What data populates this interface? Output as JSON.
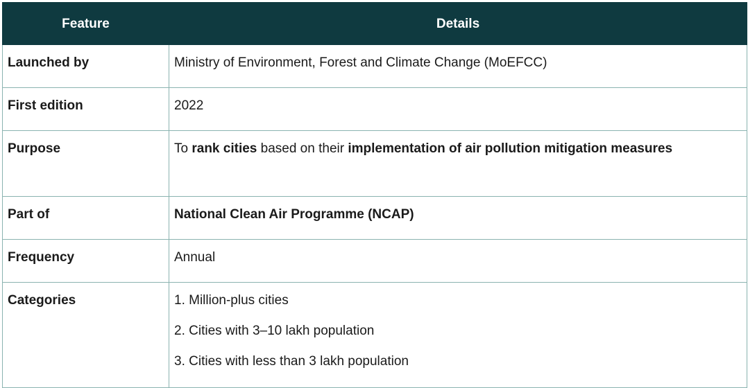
{
  "header": {
    "feature": "Feature",
    "details": "Details"
  },
  "rows": {
    "launched_by": {
      "feature": "Launched by",
      "details": "Ministry of Environment, Forest and Climate Change (MoEFCC)"
    },
    "first_edition": {
      "feature": "First edition",
      "details": "2022"
    },
    "purpose": {
      "feature": "Purpose",
      "details": {
        "part1": "To ",
        "bold1": "rank cities",
        "part2": " based on their ",
        "bold2": "implementation of air pollution mitigation measures"
      }
    },
    "part_of": {
      "feature": "Part of",
      "details": "National Clean Air Programme (NCAP)"
    },
    "frequency": {
      "feature": "Frequency",
      "details": "Annual"
    },
    "categories": {
      "feature": "Categories",
      "items": [
        "1. Million-plus cities",
        "2. Cities with 3–10 lakh population",
        "3. Cities with less than 3 lakh population"
      ]
    }
  },
  "colors": {
    "header_bg": "#0f3a40",
    "border": "#8ab3b0"
  }
}
